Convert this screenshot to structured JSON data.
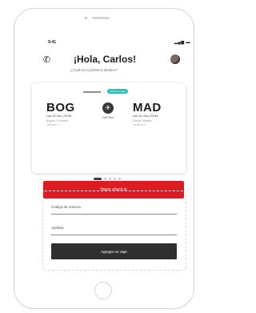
{
  "status_bar": {
    "time": "9:41",
    "icons": "▂▄▆ ▬"
  },
  "header": {
    "greeting": "¡Hola, Carlos!",
    "subtitle": "¿Cuál es tu próximo destino?"
  },
  "flight_card": {
    "badge": "Próximo vuelo",
    "origin": {
      "code": "BOG",
      "date": "Lun 24 Jun | 13:00",
      "city": "Bogotá, Colombia",
      "terminal": "Terminal 1"
    },
    "destination": {
      "code": "MAD",
      "date": "Lun 24 Jun | 23:30",
      "city": "Madrid, Barajas",
      "terminal": "Terminal 4"
    },
    "duration": "10h 30m",
    "action_label": "Hacer check-in"
  },
  "pagination": {
    "count": 5,
    "active_index": 0
  },
  "booking_form": {
    "reservation_code_label": "Código de reserva",
    "last_name_label": "Apellido",
    "submit_label": "Agregar un viaje"
  },
  "colors": {
    "accent_red": "#dc1b22",
    "badge_teal": "#2bbfb5",
    "dark_button": "#2f2f2f"
  },
  "icons": {
    "call": "phone-icon",
    "profile": "avatar",
    "flight": "airplane-icon"
  }
}
